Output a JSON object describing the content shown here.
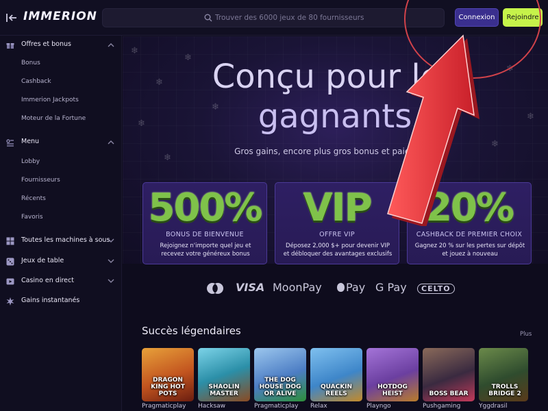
{
  "header": {
    "logo": "IMMERION",
    "search_placeholder": "Trouver des 6000 jeux de 80 fournisseurs",
    "login_label": "Connexion",
    "join_label": "Rejoindre"
  },
  "sidebar": {
    "sections": [
      {
        "label": "Offres et bonus",
        "icon": "gift-icon",
        "items": [
          "Bonus",
          "Cashback",
          "Immerion Jackpots",
          "Moteur de la Fortune"
        ]
      },
      {
        "label": "Menu",
        "icon": "menu-icon",
        "items": [
          "Lobby",
          "Fournisseurs",
          "Récents",
          "Favoris"
        ]
      },
      {
        "label": "Toutes les machines à sous",
        "icon": "grid-icon",
        "items": []
      },
      {
        "label": "Jeux de table",
        "icon": "dice-icon",
        "items": []
      },
      {
        "label": "Casino en direct",
        "icon": "live-icon",
        "items": []
      },
      {
        "label": "Gains instantanés",
        "icon": "burst-icon",
        "items": []
      }
    ]
  },
  "hero": {
    "title_line1": "Conçu pour les",
    "title_line2": "gagnants",
    "subtitle": "Gros gains, encore plus gros bonus et paiements"
  },
  "promos": [
    {
      "big": "500%",
      "title": "BONUS DE BIENVENUE",
      "desc": "Rejoignez n'importe quel jeu et recevez votre généreux bonus"
    },
    {
      "big": "VIP",
      "title": "OFFRE VIP",
      "desc": "Déposez 2,000 $+ pour devenir VIP et débloquer des avantages exclusifs"
    },
    {
      "big": "20%",
      "title": "CASHBACK DE PREMIER CHOIX",
      "desc": "Gagnez 20 % sur les pertes sur dépôt et jouez à nouveau"
    }
  ],
  "payments": [
    "VISA",
    "MoonPay",
    "Pay",
    "G Pay",
    "CELTO"
  ],
  "games_section": {
    "title": "Succès légendaires",
    "more": "Plus",
    "games": [
      {
        "name": "DRAGON KING HOT POTS",
        "provider": "Pragmaticplay",
        "color": "#c2541f"
      },
      {
        "name": "SHAOLIN MASTER",
        "provider": "Hacksaw",
        "color": "#2b8fa8"
      },
      {
        "name": "THE DOG HOUSE DOG OR ALIVE",
        "provider": "Pragmaticplay",
        "color": "#4c7dc4"
      },
      {
        "name": "QUACKIN REELS",
        "provider": "Relax",
        "color": "#3e86c9"
      },
      {
        "name": "HOTDOG HEIST",
        "provider": "Playngo",
        "color": "#6b3fa0"
      },
      {
        "name": "BOSS BEAR",
        "provider": "Pushgaming",
        "color": "#3a2a40"
      },
      {
        "name": "TROLLS BRIDGE 2",
        "provider": "Yggdrasil",
        "color": "#2f4c2e"
      }
    ]
  },
  "colors": {
    "accent": "#3a2f8e",
    "join": "#c6f34a",
    "arrow": "#e8343c",
    "promo_text": "#7fc24a"
  }
}
